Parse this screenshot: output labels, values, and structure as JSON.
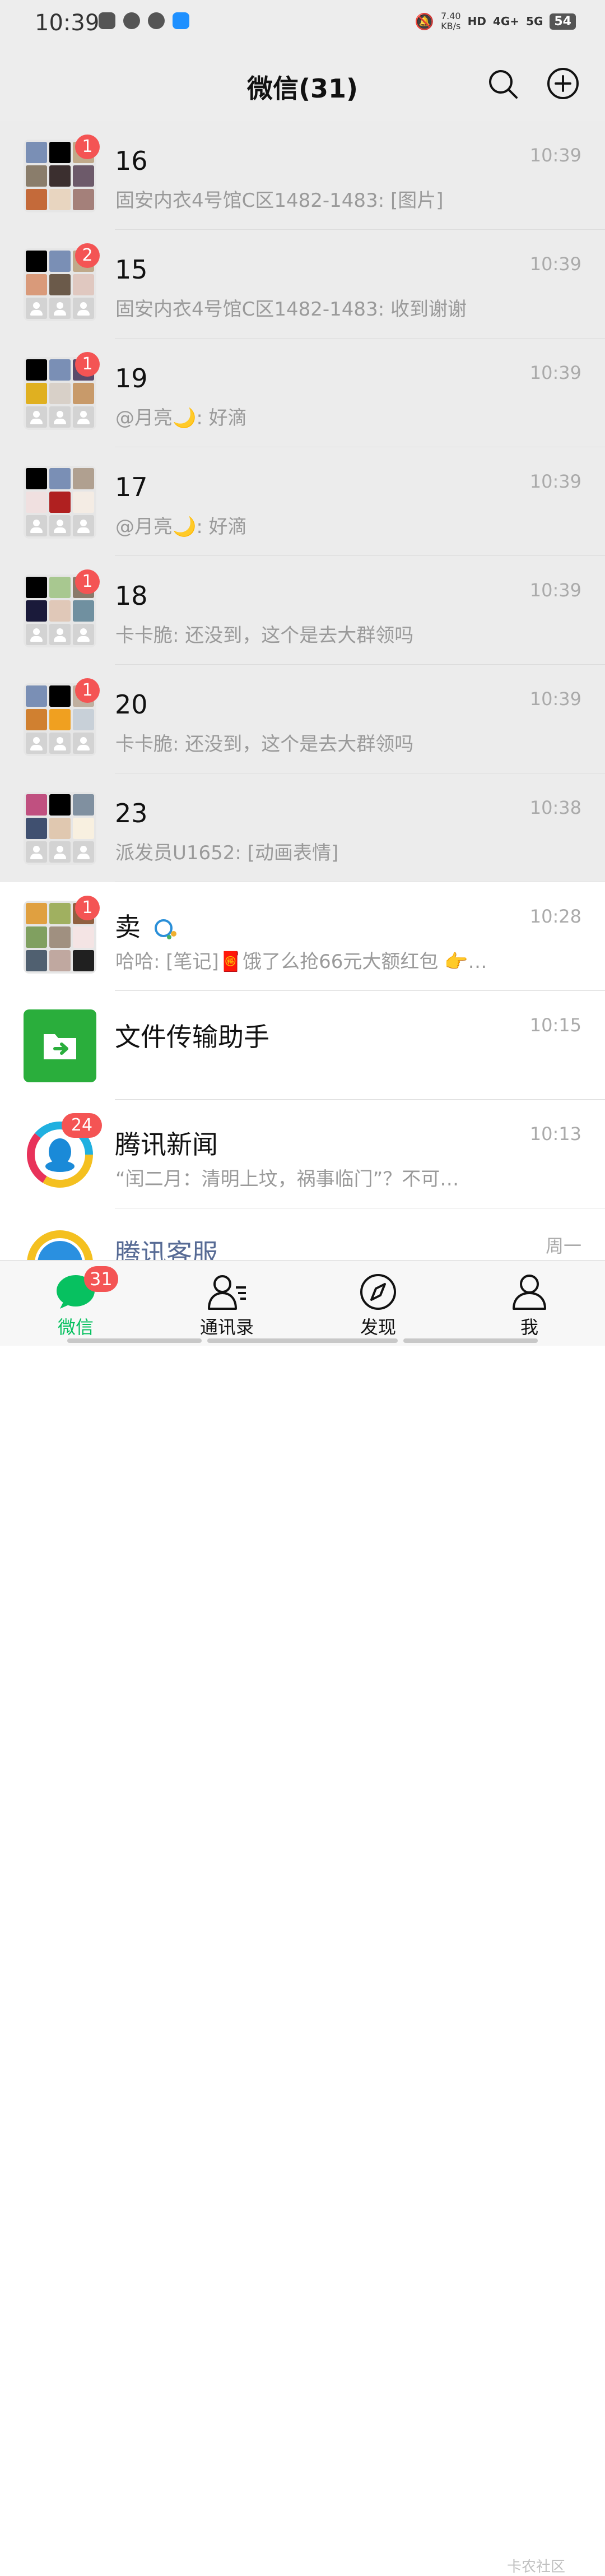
{
  "status_bar": {
    "time": "10:39",
    "net_speed_value": "7.40",
    "net_speed_unit": "KB/s",
    "hd_label": "HD",
    "signal_1": "4G+",
    "signal_2": "5G",
    "battery": "54"
  },
  "header": {
    "title": "微信(31)"
  },
  "chats": [
    {
      "name": "16",
      "preview": "固安内衣4号馆C区1482-1483: [图片]",
      "time": "10:39",
      "badge": "1",
      "pinned": true
    },
    {
      "name": "15",
      "preview": "固安内衣4号馆C区1482-1483: 收到谢谢",
      "time": "10:39",
      "badge": "2",
      "pinned": true
    },
    {
      "name": "19",
      "preview": "@月亮🌙: 好滴",
      "time": "10:39",
      "badge": "1",
      "pinned": true
    },
    {
      "name": "17",
      "preview": "@月亮🌙: 好滴",
      "time": "10:39",
      "badge": "",
      "pinned": true
    },
    {
      "name": "18",
      "preview": "卡卡脆: 还没到，这个是去大群领吗",
      "time": "10:39",
      "badge": "1",
      "pinned": true
    },
    {
      "name": "20",
      "preview": "卡卡脆: 还没到，这个是去大群领吗",
      "time": "10:39",
      "badge": "1",
      "pinned": true
    },
    {
      "name": "23",
      "preview": "派发员U1652: [动画表情]",
      "time": "10:38",
      "badge": "",
      "pinned": true
    },
    {
      "name": "卖",
      "preview": "哈哈: [笔记]🧧饿了么抢66元大额红包 👉…",
      "time": "10:28",
      "badge": "1",
      "pinned": false
    },
    {
      "name": "文件传输助手",
      "preview": "",
      "time": "10:15",
      "badge": "",
      "pinned": false
    },
    {
      "name": "腾讯新闻",
      "preview": "“闰二月：清明上坟，祸事临门”？不可…",
      "time": "10:13",
      "badge": "24",
      "pinned": false
    },
    {
      "name": "腾讯客服",
      "preview": "",
      "time": "周一",
      "badge": "",
      "pinned": false
    }
  ],
  "tabs": [
    {
      "label": "微信",
      "badge": "31",
      "active": true
    },
    {
      "label": "通讯录",
      "badge": "",
      "active": false
    },
    {
      "label": "发现",
      "badge": "",
      "active": false
    },
    {
      "label": "我",
      "badge": "",
      "active": false
    }
  ],
  "watermark": "卡农社区",
  "colors": {
    "accent_green": "#07c160",
    "badge_red": "#f45454",
    "pinned_bg": "#ececec",
    "header_bg": "#ededed",
    "link_blue": "#576b95"
  }
}
